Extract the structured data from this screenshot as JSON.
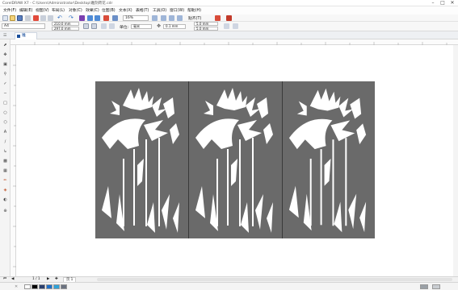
{
  "window": {
    "title": "CorelDRAW X7 - C:\\Users\\Administrator\\Desktop\\雕刻荷花.cdr",
    "controls": [
      "–",
      "□",
      "✕"
    ]
  },
  "menu": [
    "文件(F)",
    "编辑(E)",
    "视图(V)",
    "布局(L)",
    "对象(C)",
    "效果(C)",
    "位图(B)",
    "文本(X)",
    "表格(T)",
    "工具(O)",
    "窗口(W)",
    "帮助(H)"
  ],
  "toolbar": {
    "zoom": "16%",
    "snap_label": "贴齐(T)"
  },
  "property_bar": {
    "page_size": "A4",
    "width": "210.0 mm",
    "height": "297.0 mm",
    "unit_label": "单位:",
    "unit_value": "毫米",
    "nudge": "0.1 mm",
    "dup_x": "5.0 mm",
    "dup_y": "5.0 mm"
  },
  "document_tab": "雕花.cdr",
  "status": {
    "page_counter": "1 / 1",
    "page_tab": "页 1"
  },
  "colors": {
    "artboard": "#6a6a6a",
    "accent": "#1a4f9c"
  },
  "palette": [
    "#ffffff",
    "#000000",
    "#2a3f6e",
    "#1f6fc8",
    "#2fa3d9",
    "#6b7280",
    "#9aa0a6",
    "#c9cdd2"
  ]
}
